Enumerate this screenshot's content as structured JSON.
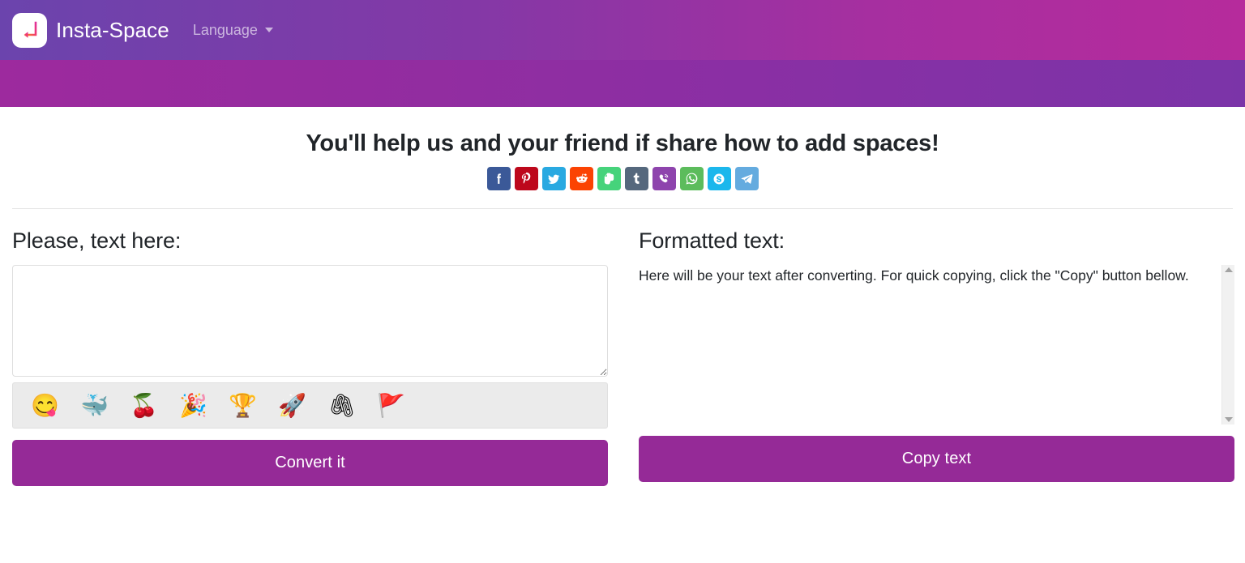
{
  "navbar": {
    "logo_icon": "insta-space-return-arrow-logo",
    "brand": "Insta-Space",
    "language_label": "Language",
    "caret_icon": "chevron-down-icon",
    "gradient_from": "#6b44ad",
    "gradient_to": "#b62b9c"
  },
  "subbar": {
    "gradient_from": "#9d2a9e",
    "gradient_to": "#7b34a8"
  },
  "share": {
    "title": "You'll help us and your friend if share how to add spaces!",
    "buttons": [
      {
        "name": "facebook",
        "label": "Facebook",
        "icon": "facebook-icon",
        "color": "#3b5998"
      },
      {
        "name": "pinterest",
        "label": "Pinterest",
        "icon": "pinterest-icon",
        "color": "#bd081c"
      },
      {
        "name": "twitter",
        "label": "Twitter",
        "icon": "twitter-icon",
        "color": "#29a9e1"
      },
      {
        "name": "reddit",
        "label": "Reddit",
        "icon": "reddit-icon",
        "color": "#fb4303"
      },
      {
        "name": "evernote",
        "label": "Evernote",
        "icon": "evernote-icon",
        "color": "#46d37b"
      },
      {
        "name": "tumblr",
        "label": "Tumblr",
        "icon": "tumblr-icon",
        "color": "#55687d"
      },
      {
        "name": "viber",
        "label": "Viber",
        "icon": "viber-icon",
        "color": "#8e44ad"
      },
      {
        "name": "whatsapp",
        "label": "WhatsApp",
        "icon": "whatsapp-icon",
        "color": "#5cbc5c"
      },
      {
        "name": "skype",
        "label": "Skype",
        "icon": "skype-icon",
        "color": "#1bb7ec"
      },
      {
        "name": "telegram",
        "label": "Telegram",
        "icon": "telegram-icon",
        "color": "#64abdf"
      }
    ]
  },
  "left_panel": {
    "title": "Please, text here:",
    "textarea_value": "",
    "textarea_placeholder": "",
    "emojis": [
      {
        "glyph": "😋",
        "name": "face-savoring-food-emoji"
      },
      {
        "glyph": "🐳",
        "name": "whale-emoji"
      },
      {
        "glyph": "🍒",
        "name": "cherries-emoji"
      },
      {
        "glyph": "🎉",
        "name": "party-popper-emoji"
      },
      {
        "glyph": "🏆",
        "name": "trophy-emoji"
      },
      {
        "glyph": "🚀",
        "name": "rocket-emoji"
      },
      {
        "glyph": "🖇",
        "name": "linked-paperclips-emoji"
      },
      {
        "glyph": "🚩",
        "name": "triangular-flag-emoji"
      }
    ],
    "button_label": "Convert it"
  },
  "right_panel": {
    "title": "Formatted text:",
    "output_text": "Here will be your text after converting. For quick copying, click the \"Copy\" button bellow.",
    "button_label": "Copy text",
    "scroll_up_icon": "scroll-up-arrow-icon",
    "scroll_down_icon": "scroll-down-arrow-icon"
  },
  "theme": {
    "button_purple": "#952a97",
    "text_dark": "#212529"
  }
}
